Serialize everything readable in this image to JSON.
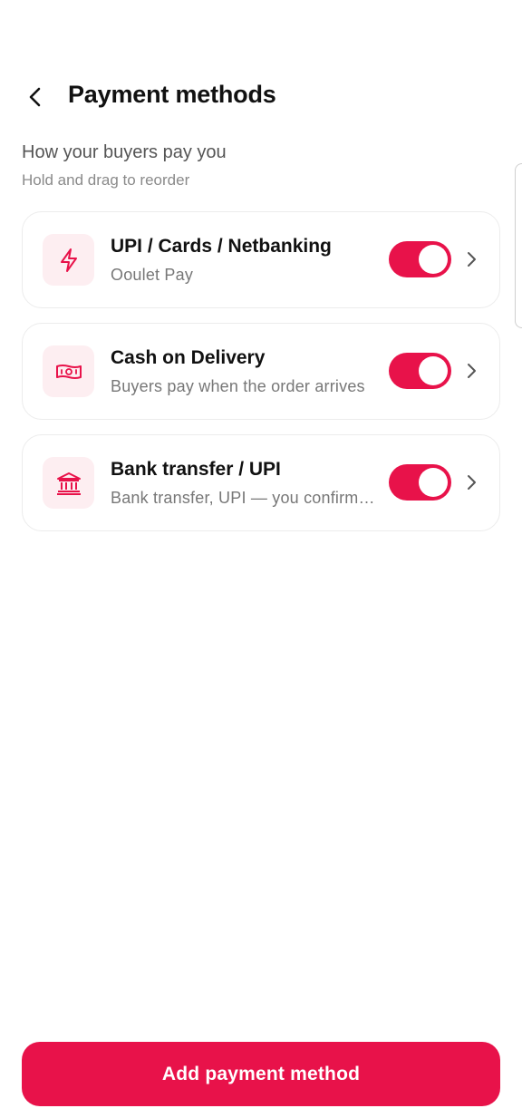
{
  "header": {
    "title": "Payment methods"
  },
  "section": {
    "title": "How your buyers pay you",
    "subtitle": "Hold and drag to reorder"
  },
  "methods": [
    {
      "title": "UPI / Cards / Netbanking",
      "subtitle": "Ooulet Pay",
      "icon": "lightning-icon",
      "enabled": true
    },
    {
      "title": "Cash on Delivery",
      "subtitle": "Buyers pay when the order arrives",
      "icon": "banknote-icon",
      "enabled": true
    },
    {
      "title": "Bank transfer / UPI",
      "subtitle": "Bank transfer, UPI — you confirm payment",
      "icon": "bank-icon",
      "enabled": true
    }
  ],
  "actions": {
    "add_label": "Add payment method"
  },
  "colors": {
    "accent": "#e8124a",
    "icon_tile": "#fdeef1"
  }
}
